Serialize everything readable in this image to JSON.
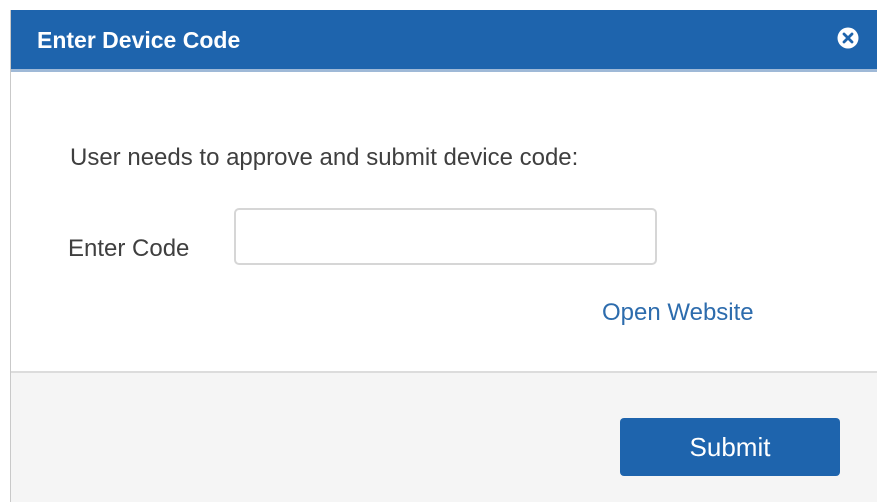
{
  "dialog": {
    "title": "Enter Device Code",
    "close_icon": "close-circle-icon"
  },
  "body": {
    "instruction": "User needs to approve and submit device code:",
    "code_label": "Enter Code",
    "code_value": "",
    "code_placeholder": "",
    "open_website_link": "Open Website"
  },
  "footer": {
    "submit_label": "Submit"
  },
  "colors": {
    "header_bg": "#1e64ad",
    "link": "#2d6cad",
    "button_bg": "#1e64ad",
    "footer_bg": "#f5f5f5"
  }
}
